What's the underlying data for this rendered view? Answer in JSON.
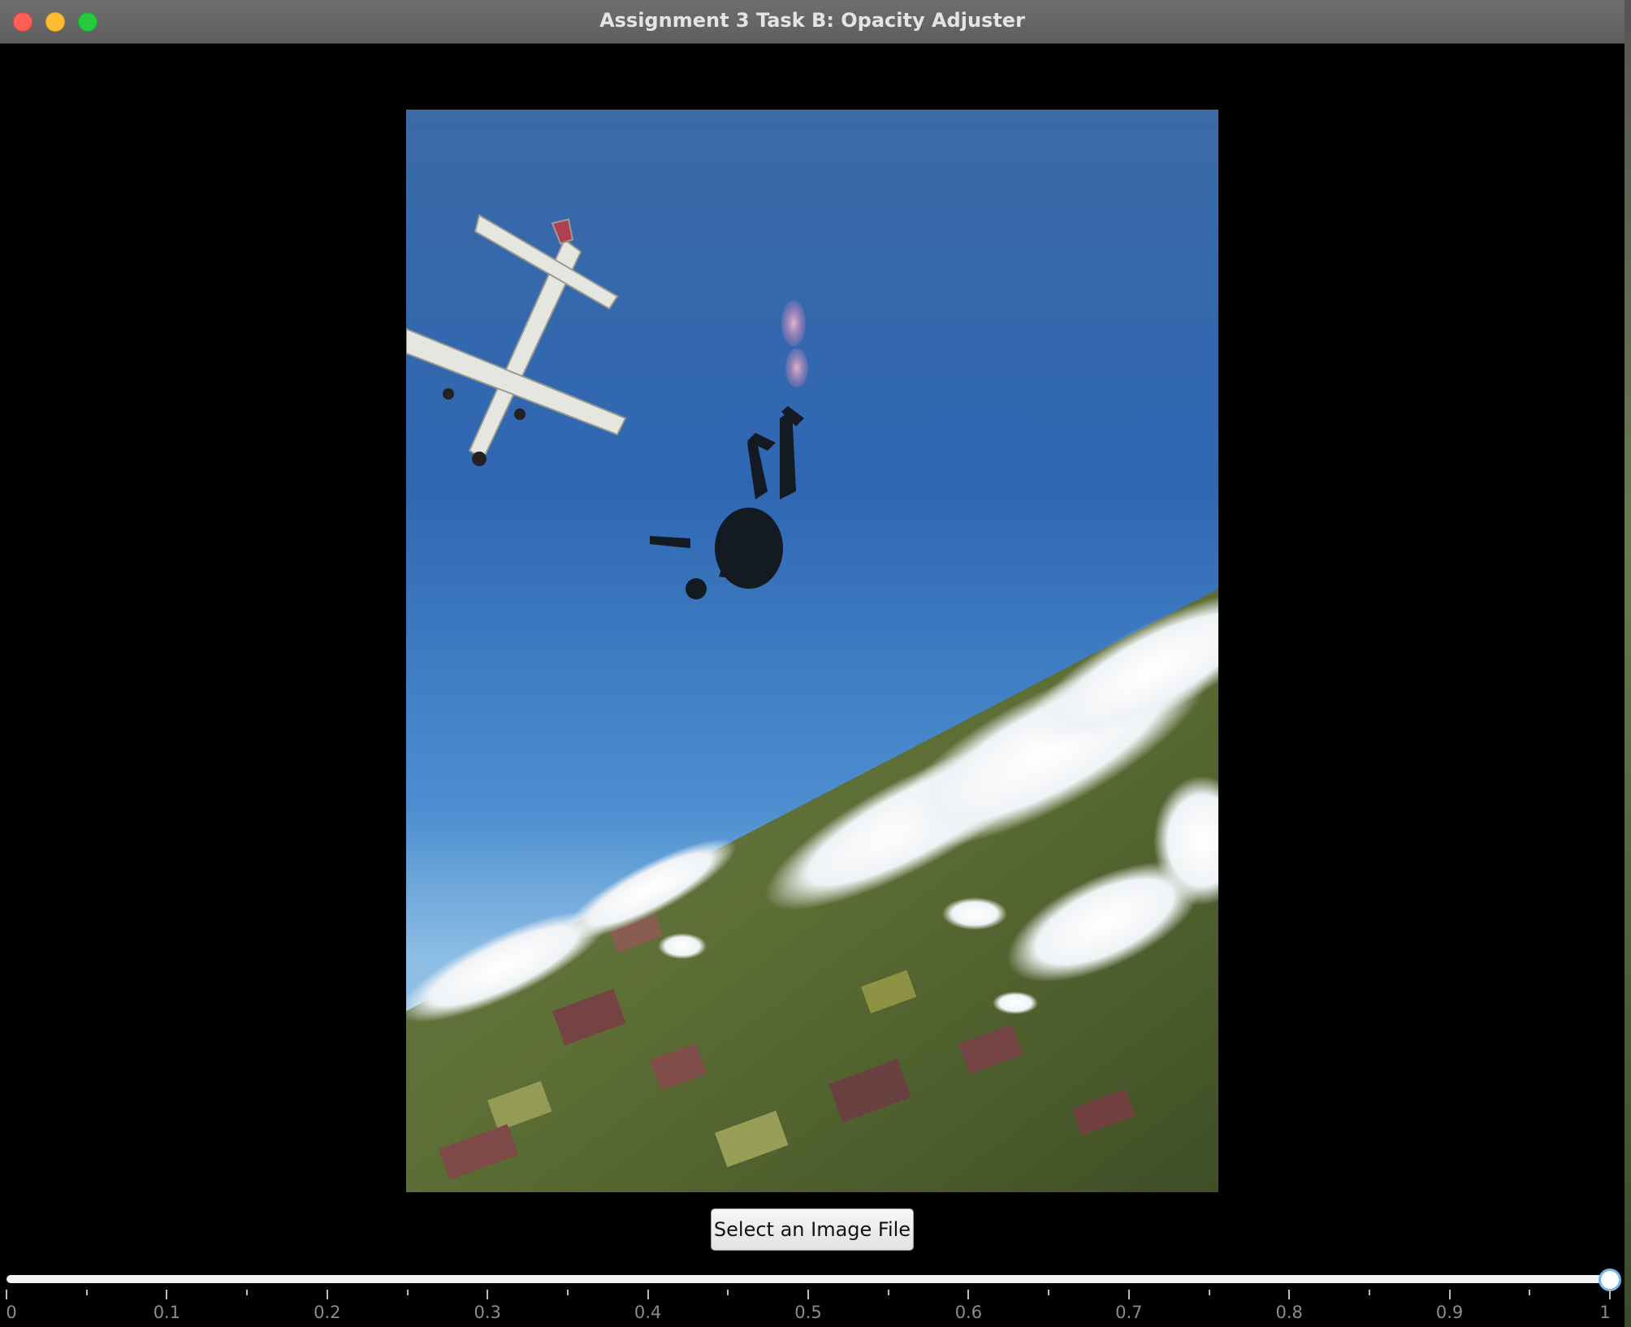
{
  "window": {
    "title": "Assignment 3 Task B: Opacity Adjuster",
    "traffic_lights": [
      "close",
      "minimize",
      "zoom"
    ]
  },
  "image": {
    "description_icon": "skydiving-photo",
    "opacity": 1
  },
  "select_button": {
    "label": "Select an Image File"
  },
  "opacity_slider": {
    "min": 0,
    "max": 1,
    "value": 1,
    "major_tick_unit": 0.1,
    "minor_ticks_per_major": 1,
    "tick_labels": [
      "0",
      "0.1",
      "0.2",
      "0.3",
      "0.4",
      "0.5",
      "0.6",
      "0.7",
      "0.8",
      "0.9",
      "1"
    ]
  },
  "colors": {
    "background": "#000000",
    "titlebar": "#666666",
    "thumb_border": "#6fb7ee"
  }
}
